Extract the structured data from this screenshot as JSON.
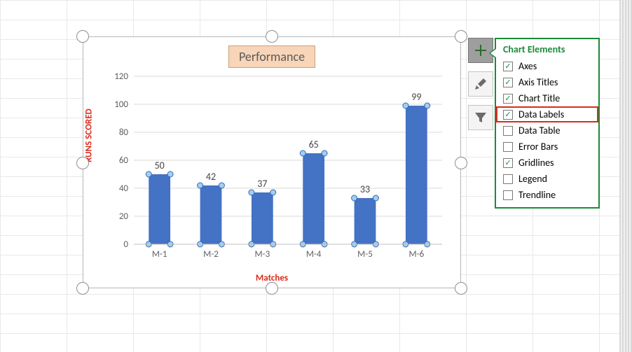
{
  "chart_data": {
    "type": "bar",
    "title": "Performance",
    "xlabel": "Matches",
    "ylabel": "RUNS SCORED",
    "categories": [
      "M-1",
      "M-2",
      "M-3",
      "M-4",
      "M-5",
      "M-6"
    ],
    "values": [
      50,
      42,
      37,
      65,
      33,
      99
    ],
    "ylim": [
      0,
      120
    ],
    "ytick_step": 20,
    "grid": true,
    "data_labels_shown": true
  },
  "yticks": [
    "0",
    "20",
    "40",
    "60",
    "80",
    "100",
    "120"
  ],
  "tool_buttons": {
    "plus": "plus-icon",
    "brush": "brush-icon",
    "filter": "filter-icon"
  },
  "flyout": {
    "title": "Chart Elements",
    "items": [
      {
        "label": "Axes",
        "checked": true,
        "highlight": false
      },
      {
        "label": "Axis Titles",
        "checked": true,
        "highlight": false
      },
      {
        "label": "Chart Title",
        "checked": true,
        "highlight": false
      },
      {
        "label": "Data Labels",
        "checked": true,
        "highlight": true
      },
      {
        "label": "Data Table",
        "checked": false,
        "highlight": false
      },
      {
        "label": "Error Bars",
        "checked": false,
        "highlight": false
      },
      {
        "label": "Gridlines",
        "checked": true,
        "highlight": false
      },
      {
        "label": "Legend",
        "checked": false,
        "highlight": false
      },
      {
        "label": "Trendline",
        "checked": false,
        "highlight": false
      }
    ]
  }
}
